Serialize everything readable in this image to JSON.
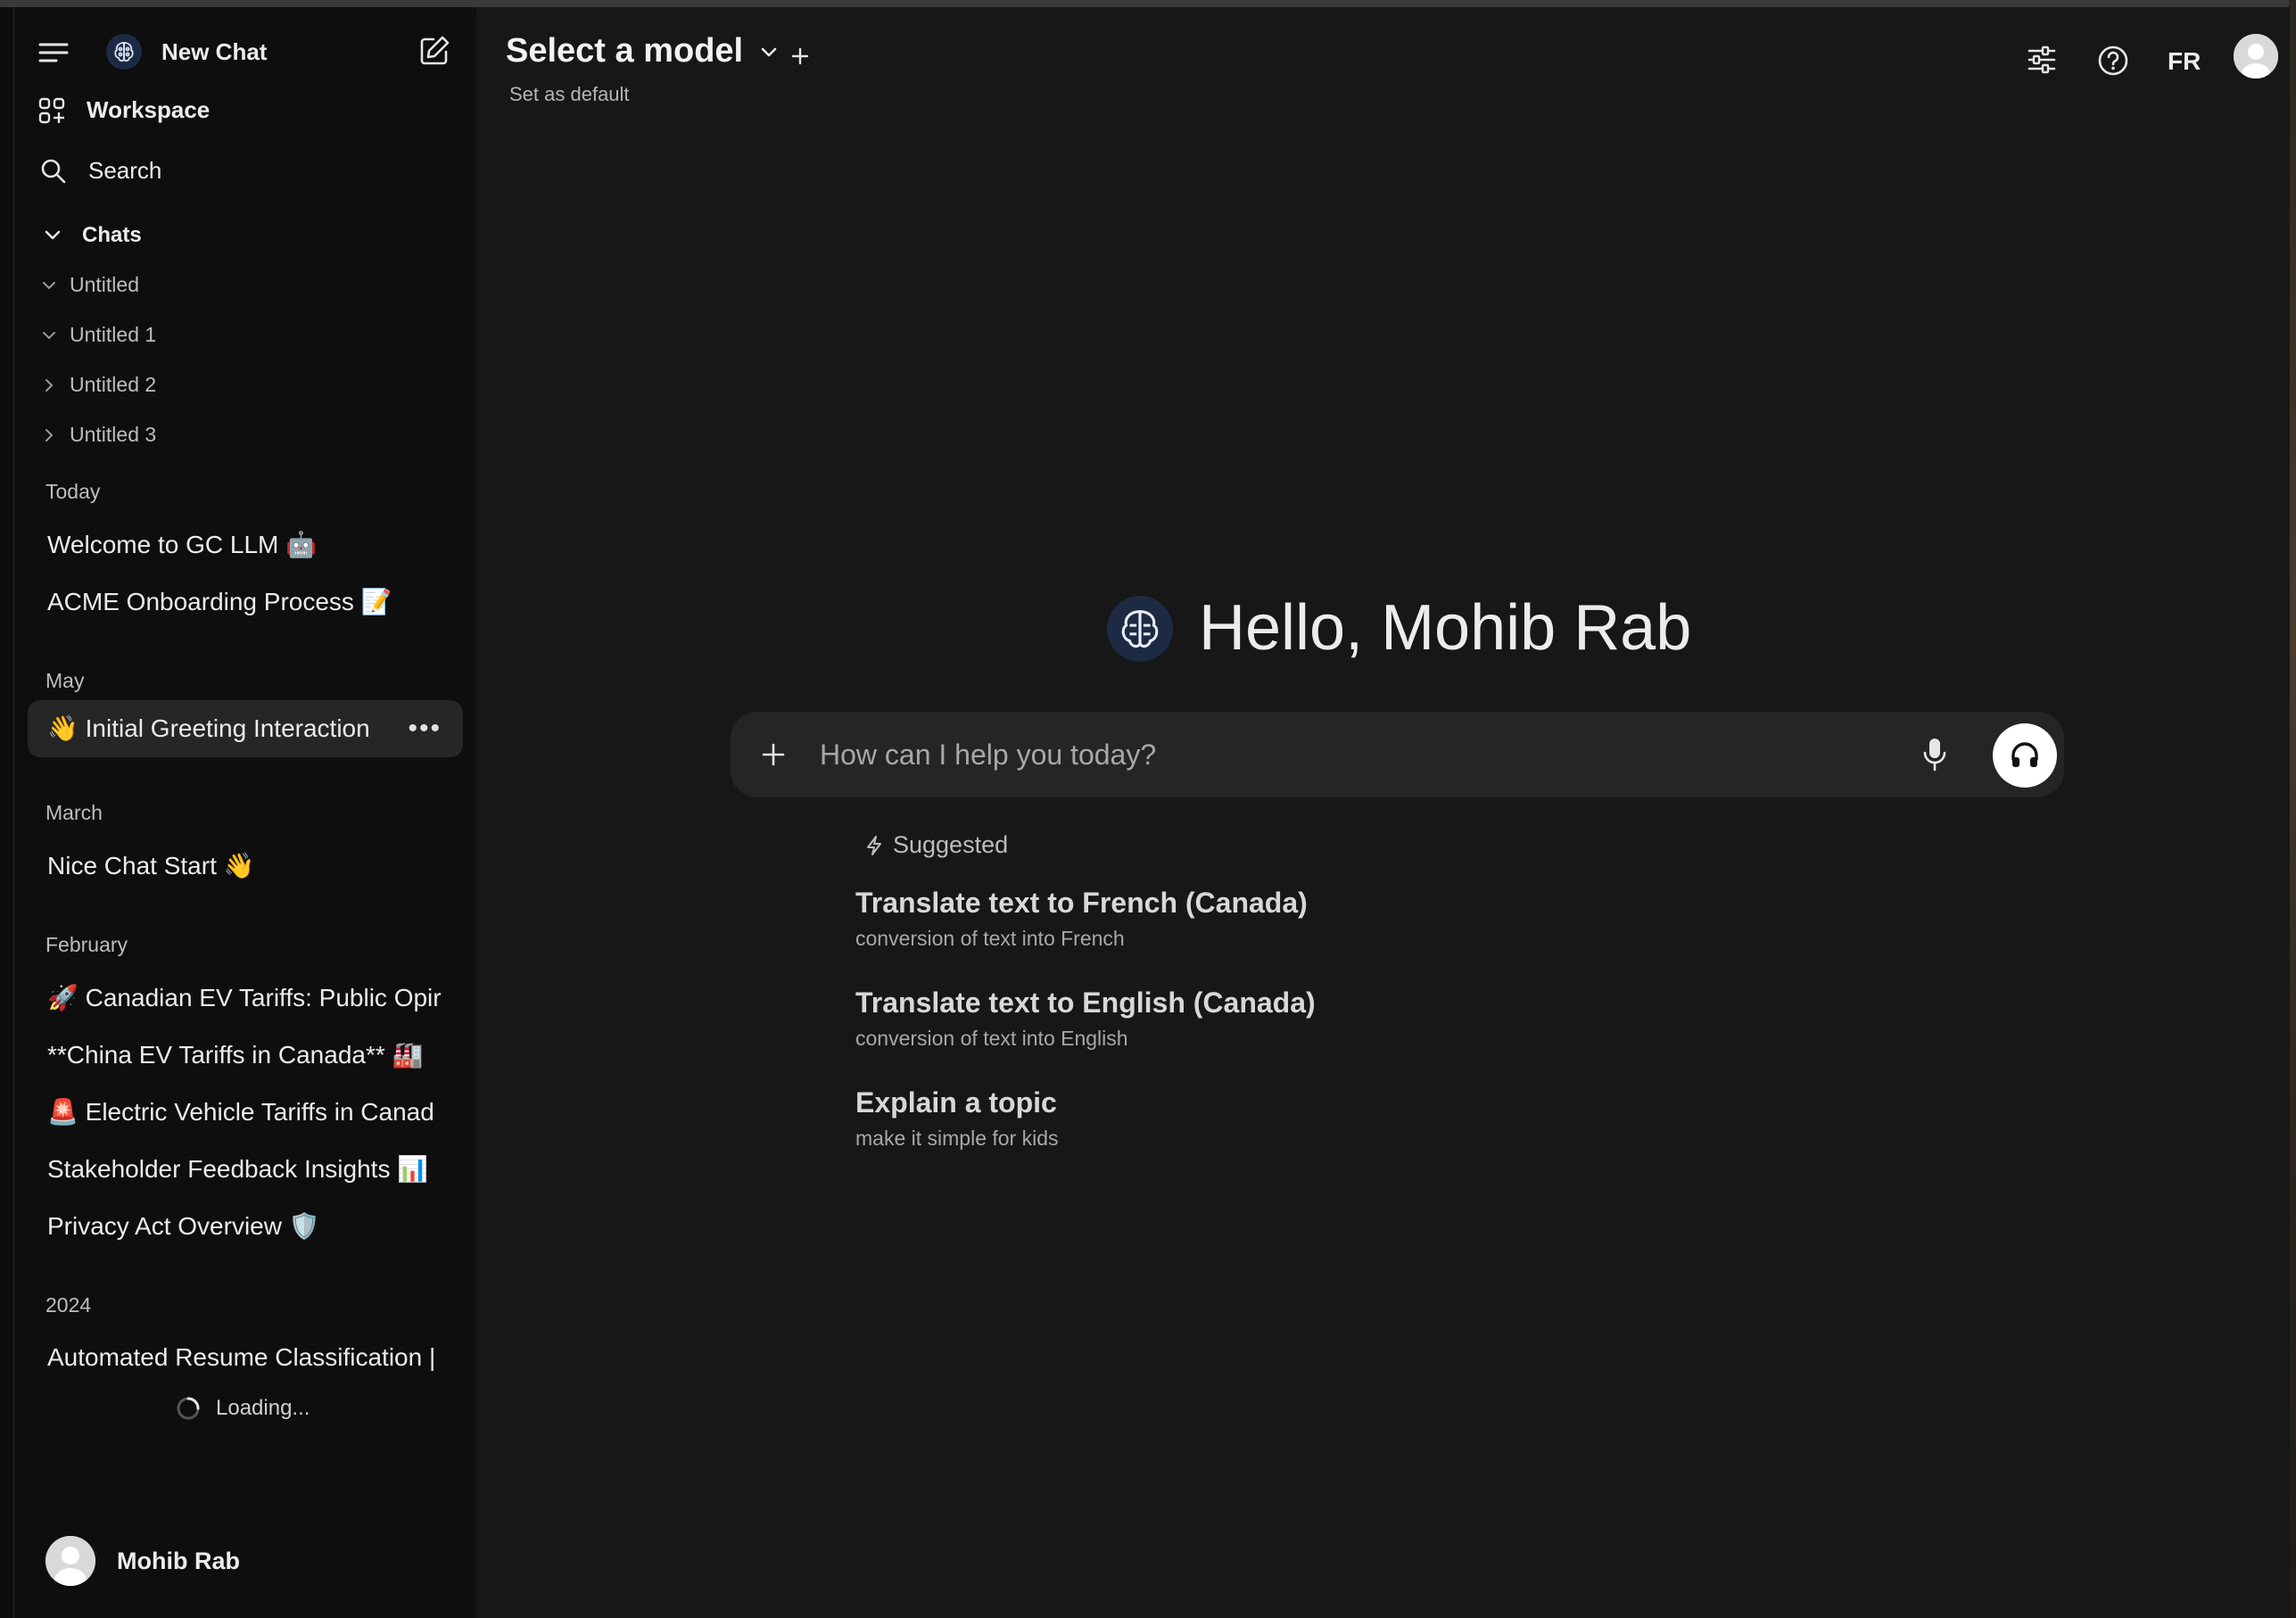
{
  "sidebar": {
    "new_chat": "New Chat",
    "workspace": "Workspace",
    "search": "Search",
    "chats_section": "Chats",
    "folders": [
      {
        "label": "Untitled",
        "expanded": true
      },
      {
        "label": "Untitled 1",
        "expanded": true
      },
      {
        "label": "Untitled 2",
        "expanded": false
      },
      {
        "label": "Untitled 3",
        "expanded": false
      }
    ],
    "groups": {
      "today": "Today",
      "may": "May",
      "march": "March",
      "february": "February",
      "y2024": "2024"
    },
    "chats": {
      "today_0": "Welcome to GC LLM 🤖",
      "today_1": "ACME Onboarding Process 📝",
      "may_0": "👋 Initial Greeting Interaction",
      "march_0": "Nice Chat Start 👋",
      "feb_0": "🚀 Canadian EV Tariffs: Public Opir",
      "feb_1": "**China EV Tariffs in Canada** 🏭",
      "feb_2": "🚨 Electric Vehicle Tariffs in Canad",
      "feb_3": "Stakeholder Feedback Insights 📊",
      "feb_4": "Privacy Act Overview 🛡️",
      "y2024_0": "Automated Resume Classification |"
    },
    "more_dots": "•••",
    "loading": "Loading...",
    "user_name": "Mohib Rab"
  },
  "header": {
    "model_selector": "Select a model",
    "set_default": "Set as default",
    "language": "FR"
  },
  "main": {
    "greeting": "Hello, Mohib Rab",
    "input_placeholder": "How can I help you today?",
    "suggested_label": "Suggested",
    "suggestions": [
      {
        "title": "Translate text to French (Canada)",
        "subtitle": "conversion of text into French"
      },
      {
        "title": "Translate text to English (Canada)",
        "subtitle": "conversion of text into English"
      },
      {
        "title": "Explain a topic",
        "subtitle": "make it simple for kids"
      }
    ]
  },
  "colors": {
    "sidebar_bg": "#0e0e0e",
    "main_bg": "#171717",
    "active_chat_bg": "#262626",
    "input_bg": "#252525"
  }
}
